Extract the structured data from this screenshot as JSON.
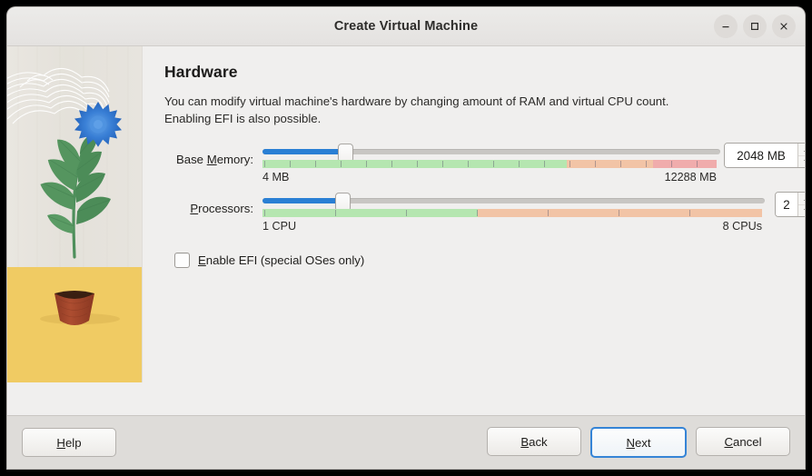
{
  "window": {
    "title": "Create Virtual Machine",
    "controls": {
      "minimize": "minimize-icon",
      "maximize": "maximize-icon",
      "close": "close-icon"
    }
  },
  "page": {
    "title": "Hardware",
    "description": "You can modify virtual machine's hardware by changing amount of RAM and virtual CPU count. Enabling EFI is also possible."
  },
  "fields": {
    "base_memory": {
      "label_pre": "Base ",
      "label_accel": "M",
      "label_post": "emory:",
      "label_full": "Base Memory:",
      "value": "2048 MB",
      "min_label": "4 MB",
      "max_label": "12288 MB",
      "min": 4,
      "max": 12288,
      "current": 2048,
      "fill_percent": 17,
      "bands": [
        {
          "name": "optimal",
          "color": "#b5e6b0",
          "percent": 67
        },
        {
          "name": "warning",
          "color": "#f2c4a6",
          "percent": 19
        },
        {
          "name": "danger",
          "color": "#f0acac",
          "percent": 14
        }
      ]
    },
    "processors": {
      "label_pre": "",
      "label_accel": "P",
      "label_post": "rocessors:",
      "label_full": "Processors:",
      "value": "2",
      "min_label": "1 CPU",
      "max_label": "8 CPUs",
      "min": 1,
      "max": 8,
      "current": 2,
      "fill_percent": 14.3,
      "bands": [
        {
          "name": "optimal",
          "color": "#b5e6b0",
          "percent": 43
        },
        {
          "name": "warning",
          "color": "#f2c4a6",
          "percent": 57
        }
      ]
    },
    "enable_efi": {
      "label_pre": "",
      "label_accel": "E",
      "label_post": "nable EFI (special OSes only)",
      "label_full": "Enable EFI (special OSes only)",
      "checked": false
    }
  },
  "footer": {
    "help": {
      "pre": "",
      "accel": "H",
      "post": "elp",
      "full": "Help"
    },
    "back": {
      "pre": "",
      "accel": "B",
      "post": "ack",
      "full": "Back"
    },
    "next": {
      "pre": "",
      "accel": "N",
      "post": "ext",
      "full": "Next"
    },
    "cancel": {
      "pre": "",
      "accel": "C",
      "post": "ancel",
      "full": "Cancel"
    }
  },
  "theme": {
    "accent": "#2a7fd4",
    "window_bg": "#f0efee",
    "footer_bg": "#dedcd9",
    "art_sky": "#e6e3dd",
    "art_ground": "#f0cb63",
    "art_flower": "#2f77cf",
    "art_leaf": "#4e8f5b",
    "art_pot": "#a0422a"
  }
}
